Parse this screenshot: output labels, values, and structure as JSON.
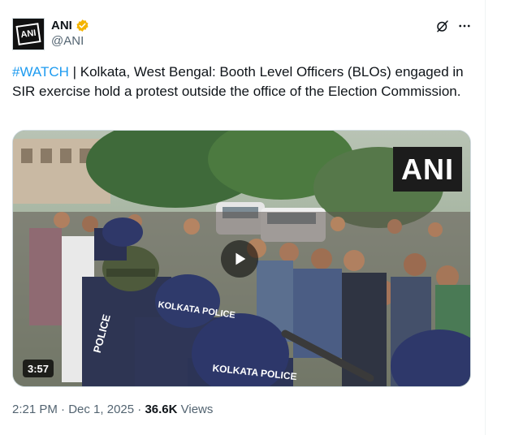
{
  "author": {
    "display_name": "ANI",
    "handle": "@ANI",
    "avatar_text": "ANI",
    "verified": true,
    "verified_color": "#f4b400"
  },
  "tweet": {
    "hashtag": "#WATCH",
    "separator": " | ",
    "body": "Kolkata, West Bengal: Booth Level Officers (BLOs) engaged in SIR exercise hold a protest outside the office of the Election Commission."
  },
  "media": {
    "watermark": "ANI",
    "duration": "3:57",
    "play_icon": "play-icon",
    "helmet_text": "KOLKATA POLICE",
    "vest_text": "POLICE"
  },
  "meta": {
    "time": "2:21 PM",
    "dot": " · ",
    "date": "Dec 1, 2025",
    "views_count": "36.6K",
    "views_label": " Views"
  },
  "colors": {
    "link": "#1d9bf0",
    "text": "#0f1419",
    "secondary": "#536471"
  }
}
